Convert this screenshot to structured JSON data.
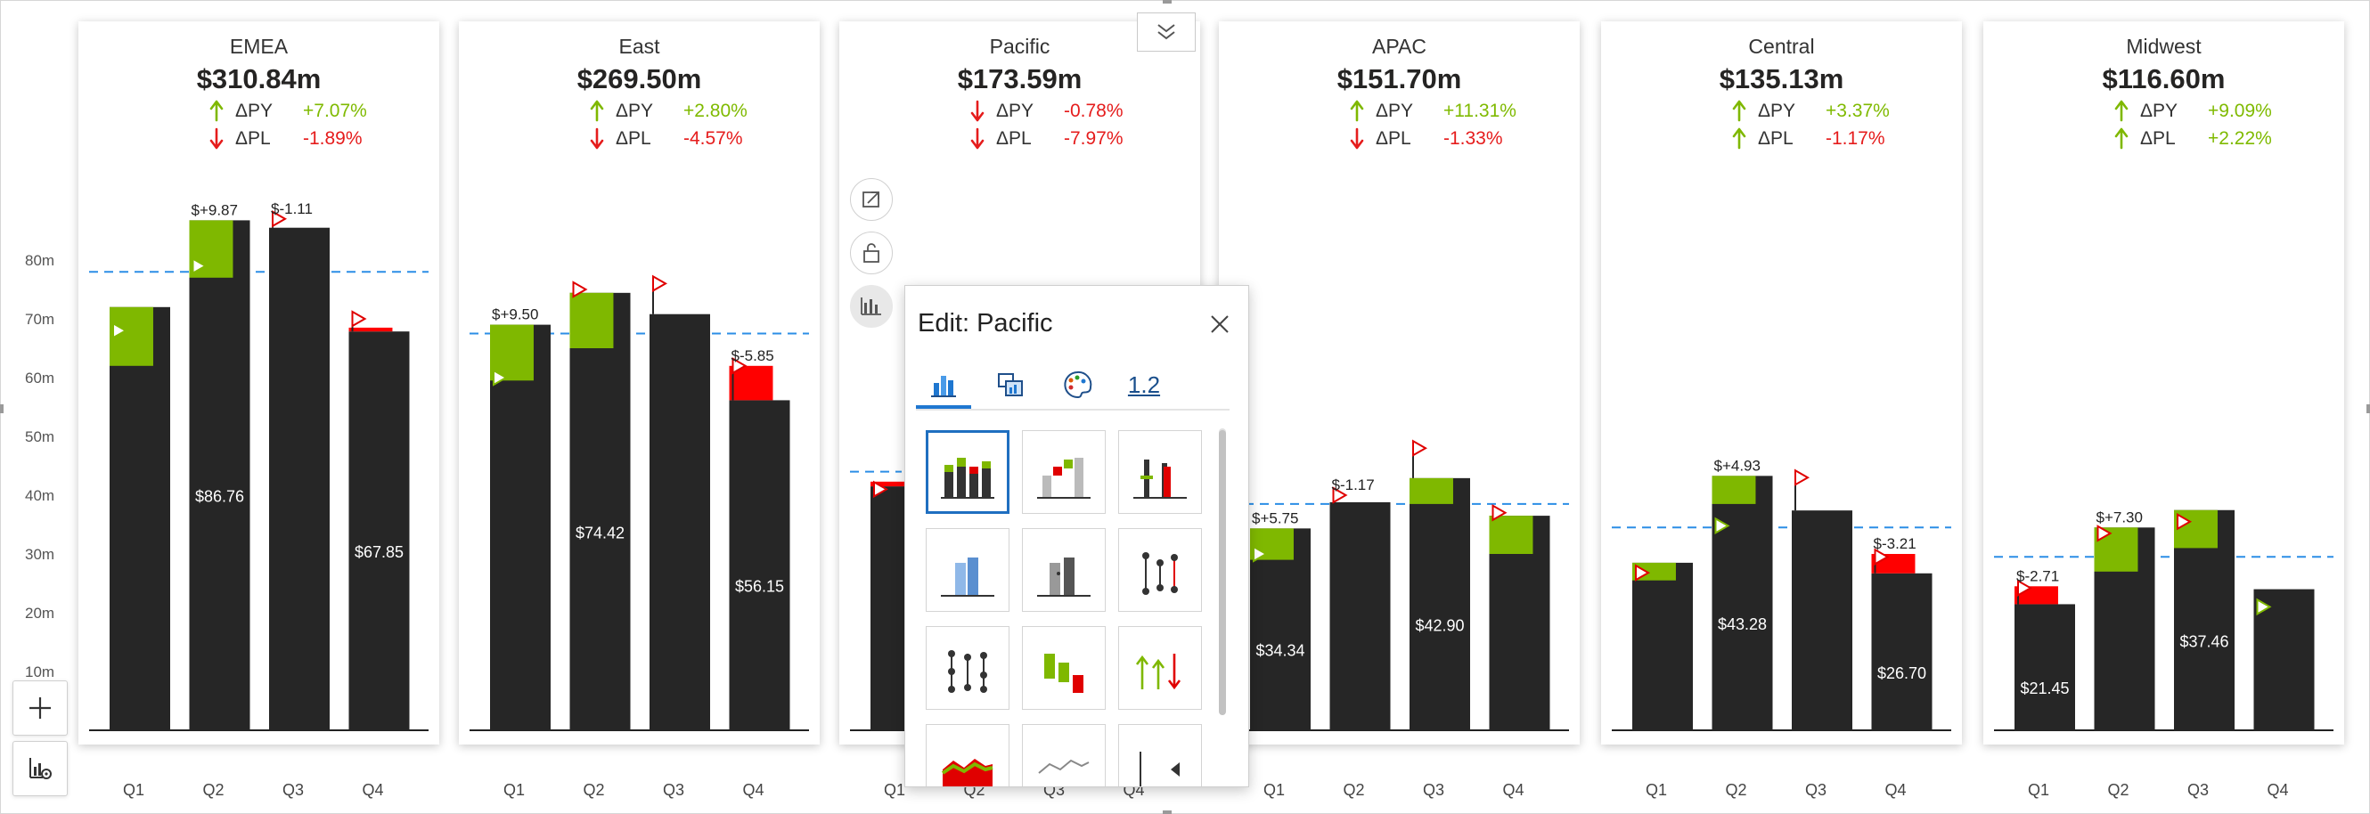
{
  "chart_data": [
    {
      "type": "bar",
      "title": "EMEA",
      "total": "$310.84m",
      "dpy": "+7.07%",
      "dpl": "-1.89%",
      "dpy_dir": "up",
      "dpl_dir": "down",
      "categories": [
        "Q1",
        "Q2",
        "Q3",
        "Q4"
      ],
      "values": [
        72,
        86.76,
        85.5,
        67.85
      ],
      "py": [
        62,
        77,
        85.5,
        68.5
      ],
      "pl": [
        68,
        79,
        87,
        70
      ],
      "value_labels": [
        "",
        "$86.76",
        "",
        "$67.85"
      ],
      "variance_labels": [
        "",
        "$+9.87",
        "$-1.11",
        ""
      ],
      "target": 78,
      "ylim": [
        0,
        80
      ]
    },
    {
      "type": "bar",
      "title": "East",
      "total": "$269.50m",
      "dpy": "+2.80%",
      "dpl": "-4.57%",
      "dpy_dir": "up",
      "dpl_dir": "down",
      "categories": [
        "Q1",
        "Q2",
        "Q3",
        "Q4"
      ],
      "values": [
        69,
        74.42,
        70.8,
        56.15
      ],
      "py": [
        59.5,
        65,
        70.8,
        62
      ],
      "pl": [
        60,
        75,
        76,
        62
      ],
      "value_labels": [
        "",
        "$74.42",
        "",
        "$56.15"
      ],
      "variance_labels": [
        "$+9.50",
        "",
        "",
        "$-5.85"
      ],
      "target": 67.5,
      "ylim": [
        0,
        80
      ]
    },
    {
      "type": "bar",
      "title": "Pacific",
      "total": "$173.59m",
      "dpy": "-0.78%",
      "dpl": "-7.97%",
      "dpy_dir": "down",
      "dpl_dir": "down",
      "categories": [
        "Q1",
        "Q2",
        "Q3",
        "Q4"
      ],
      "values": [
        41.5
      ],
      "py": [
        42.3
      ],
      "pl": [
        41
      ],
      "value_labels": [
        ""
      ],
      "variance_labels": [
        ""
      ],
      "target": 44,
      "ylim": [
        0,
        80
      ]
    },
    {
      "type": "bar",
      "title": "APAC",
      "total": "$151.70m",
      "dpy": "+11.31%",
      "dpl": "-1.33%",
      "dpy_dir": "up",
      "dpl_dir": "down",
      "categories": [
        "Q1",
        "Q2",
        "Q3",
        "Q4"
      ],
      "values": [
        34.34,
        38.8,
        42.9,
        36.5
      ],
      "py": [
        29,
        38.8,
        38.5,
        30
      ],
      "pl": [
        30,
        40,
        48,
        37
      ],
      "value_labels": [
        "$34.34",
        "",
        "$42.90",
        ""
      ],
      "variance_labels": [
        "$+5.75",
        "$-1.17",
        "",
        ""
      ],
      "target": 38.5,
      "ylim": [
        0,
        80
      ]
    },
    {
      "type": "bar",
      "title": "Central",
      "total": "$135.13m",
      "dpy": "+3.37%",
      "dpl": "-1.17%",
      "dpy_dir": "up",
      "dpl_dir": "up",
      "categories": [
        "Q1",
        "Q2",
        "Q3",
        "Q4"
      ],
      "values": [
        28.5,
        43.28,
        37.4,
        26.7
      ],
      "py": [
        25.5,
        38.5,
        37.4,
        30
      ],
      "pl": [
        26.8,
        34.8,
        43,
        29.5
      ],
      "value_labels": [
        "",
        "$43.28",
        "",
        "$26.70"
      ],
      "variance_labels": [
        "",
        "$+4.93",
        "",
        "$-3.21"
      ],
      "target": 34.5,
      "ylim": [
        0,
        80
      ]
    },
    {
      "type": "bar",
      "title": "Midwest",
      "total": "$116.60m",
      "dpy": "+9.09%",
      "dpl": "+2.22%",
      "dpy_dir": "up",
      "dpl_dir": "up",
      "categories": [
        "Q1",
        "Q2",
        "Q3",
        "Q4"
      ],
      "values": [
        21.45,
        34.5,
        37.46,
        24
      ],
      "py": [
        24.5,
        27,
        31,
        24
      ],
      "pl": [
        24.2,
        33.5,
        35.5,
        21
      ],
      "value_labels": [
        "$21.45",
        "",
        "$37.46",
        ""
      ],
      "variance_labels": [
        "$-2.71",
        "$+7.30",
        "",
        ""
      ],
      "target": 29.5,
      "ylim": [
        0,
        80
      ]
    }
  ],
  "y_axis": {
    "ticks": [
      10,
      20,
      30,
      40,
      50,
      60,
      70,
      80
    ],
    "tick_labels": [
      "10m",
      "20m",
      "30m",
      "40m",
      "50m",
      "60m",
      "70m",
      "80m"
    ]
  },
  "labels": {
    "dpy": "ΔPY",
    "dpl": "ΔPL"
  },
  "colors": {
    "actual": "#262626",
    "positive": "#7fb800",
    "negative": "#ff0000",
    "target": "#2b8ee6",
    "flag": "#e00000"
  },
  "edit_panel": {
    "prefix": "Edit:",
    "name": "Pacific",
    "tab_number": "1.2"
  },
  "icons": {
    "collapse": "chevron-double-down-icon",
    "focus": "expand-icon",
    "lock": "lock-icon",
    "chart_type": "bar-chart-icon",
    "add": "plus-icon",
    "chart_settings": "chart-settings-icon"
  }
}
